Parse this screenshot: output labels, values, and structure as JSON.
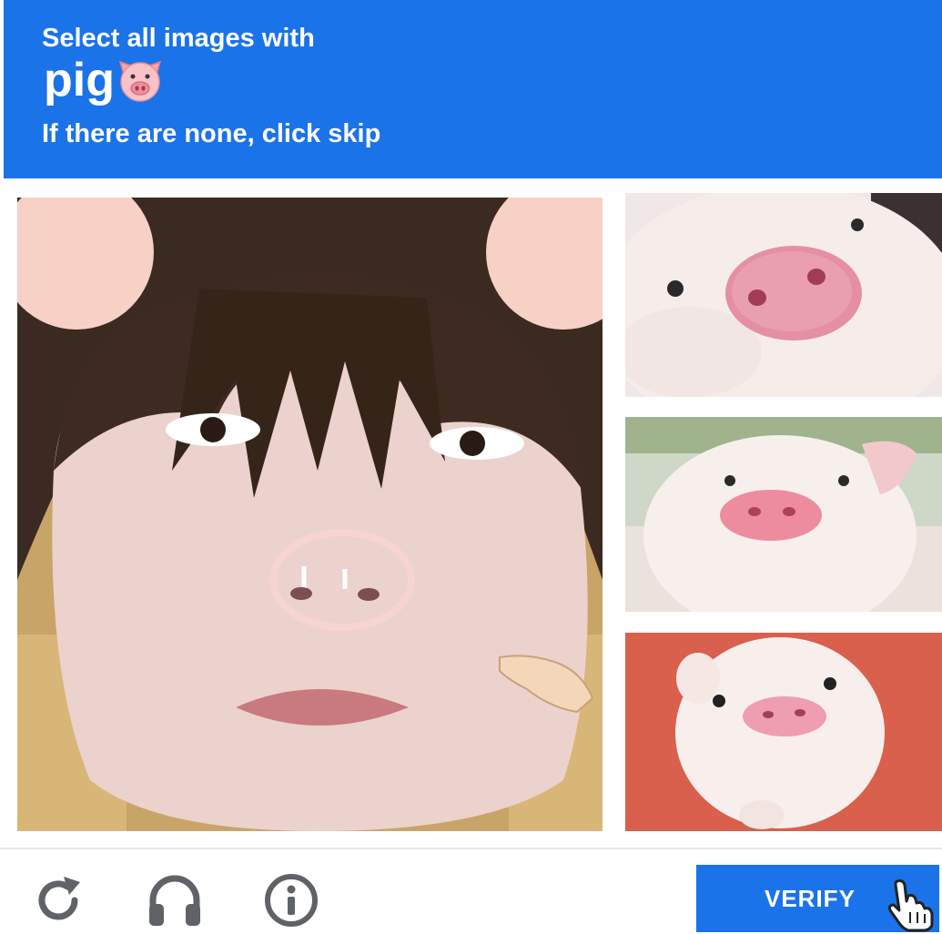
{
  "challenge": {
    "instruction": "Select all images with",
    "keyword": "pig",
    "keyword_icon": "pig-face-icon",
    "hint": "If there are none, click skip"
  },
  "tiles": [
    {
      "id": "tile-1",
      "icon": "person-with-pig-nose-filter-image"
    },
    {
      "id": "tile-2",
      "icon": "pig-closeup-image"
    },
    {
      "id": "tile-3",
      "icon": "piglet-image"
    },
    {
      "id": "tile-4",
      "icon": "piglet-red-background-image"
    }
  ],
  "footer": {
    "reload_icon": "reload-icon",
    "audio_icon": "headphones-icon",
    "info_icon": "info-icon",
    "verify_label": "VERIFY"
  },
  "colors": {
    "accent": "#1a73e8",
    "text_on_accent": "#ffffff",
    "icon_gray": "#5f6368"
  }
}
